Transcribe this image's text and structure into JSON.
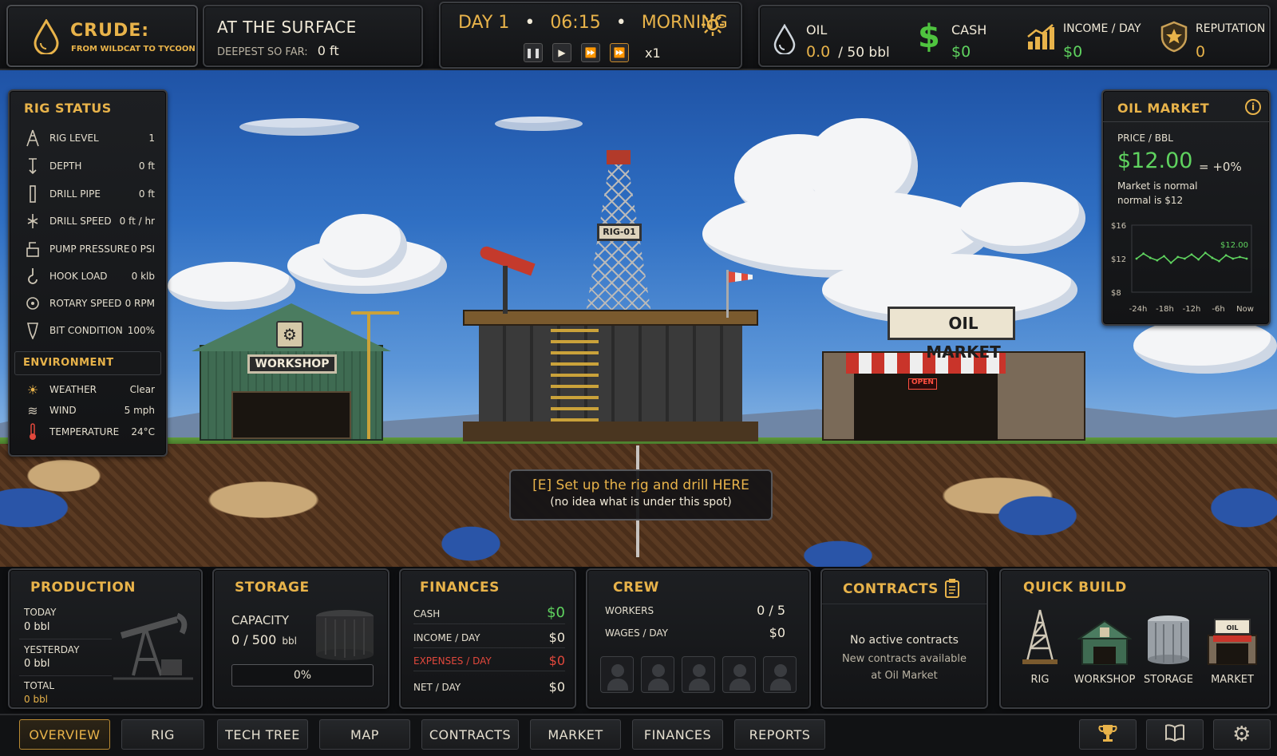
{
  "brand": {
    "title": "CRUDE:",
    "subtitle": "FROM WILDCAT TO TYCOON"
  },
  "location": {
    "title": "AT THE SURFACE",
    "deepest_label": "DEEPEST SO FAR:",
    "deepest_value": "0 ft"
  },
  "clock": {
    "day": "DAY 1",
    "time": "06:15",
    "period": "MORNING",
    "speed": "x1"
  },
  "resources": {
    "oil": {
      "label": "OIL",
      "value": "0.0",
      "capacity": "/ 50 bbl"
    },
    "cash": {
      "label": "CASH",
      "value": "$0"
    },
    "income": {
      "label": "INCOME / DAY",
      "value": "$0"
    },
    "reputation": {
      "label": "REPUTATION",
      "value": "0"
    }
  },
  "rig_status": {
    "title": "RIG STATUS",
    "rows": [
      {
        "label": "RIG LEVEL",
        "value": "1"
      },
      {
        "label": "DEPTH",
        "value": "0 ft"
      },
      {
        "label": "DRILL PIPE",
        "value": "0 ft"
      },
      {
        "label": "DRILL SPEED",
        "value": "0 ft / hr"
      },
      {
        "label": "PUMP PRESSURE",
        "value": "0 PSI"
      },
      {
        "label": "HOOK LOAD",
        "value": "0 klb"
      },
      {
        "label": "ROTARY SPEED",
        "value": "0 RPM"
      },
      {
        "label": "BIT CONDITION",
        "value": "100%"
      }
    ]
  },
  "environment": {
    "title": "ENVIRONMENT",
    "rows": [
      {
        "label": "WEATHER",
        "value": "Clear"
      },
      {
        "label": "WIND",
        "value": "5 mph"
      },
      {
        "label": "TEMPERATURE",
        "value": "24°C"
      }
    ]
  },
  "oil_market": {
    "title": "OIL MARKET",
    "price_label": "PRICE / BBL",
    "price": "$12.00",
    "change": "= +0%",
    "note": "Market is normal",
    "note2": "normal is $12"
  },
  "chart_data": {
    "type": "line",
    "x": [
      "-24h",
      "-18h",
      "-12h",
      "-6h",
      "Now"
    ],
    "x_ticks": [
      "-24h",
      "-18h",
      "-12h",
      "-6h",
      "Now"
    ],
    "y_ticks": [
      "$16",
      "$12",
      "$8"
    ],
    "ylim": [
      8,
      16
    ],
    "series": [
      {
        "values": [
          12.0,
          12.6,
          12.1,
          11.8,
          12.3,
          11.5,
          12.2,
          12.0,
          12.5,
          11.9,
          12.7,
          12.1,
          11.7,
          12.4,
          12.0,
          12.2,
          12.0
        ]
      }
    ],
    "last_label": "$12.00",
    "grid": false
  },
  "scene": {
    "workshop_sign": "WORKSHOP",
    "rig_sign": "RIG-01",
    "market_sign": "OIL MARKET",
    "open_sign": "OPEN",
    "prompt_line1": "[E] Set up the rig and drill HERE",
    "prompt_line2": "(no idea what is under this spot)"
  },
  "production": {
    "title": "PRODUCTION",
    "today_label": "TODAY",
    "today_value": "0 bbl",
    "yesterday_label": "YESTERDAY",
    "yesterday_value": "0 bbl",
    "total_label": "TOTAL",
    "total_value": "0 bbl"
  },
  "storage": {
    "title": "STORAGE",
    "capacity_label": "CAPACITY",
    "capacity_value": "0 / 500",
    "unit": "bbl",
    "percent": "0%",
    "fill": 0
  },
  "finances": {
    "title": "FINANCES",
    "rows": [
      {
        "label": "CASH",
        "value": "$0"
      },
      {
        "label": "INCOME / DAY",
        "value": "$0"
      },
      {
        "label": "EXPENSES / DAY",
        "value": "$0"
      },
      {
        "label": "NET / DAY",
        "value": "$0"
      }
    ]
  },
  "crew": {
    "title": "CREW",
    "workers_label": "WORKERS",
    "workers_value": "0 / 5",
    "wages_label": "WAGES / DAY",
    "wages_value": "$0"
  },
  "contracts": {
    "title": "CONTRACTS",
    "line1": "No active contracts",
    "line2": "New contracts available",
    "line3": "at Oil Market"
  },
  "quick_build": {
    "title": "QUICK BUILD",
    "items": [
      "RIG",
      "WORKSHOP",
      "STORAGE",
      "MARKET"
    ]
  },
  "tabs": [
    "OVERVIEW",
    "RIG",
    "TECH TREE",
    "MAP",
    "CONTRACTS",
    "MARKET",
    "FINANCES",
    "REPORTS"
  ],
  "colors": {
    "accent": "#e8b34a",
    "positive": "#5fd35f",
    "negative": "#e2483c",
    "oil": "#cfd6dd"
  }
}
